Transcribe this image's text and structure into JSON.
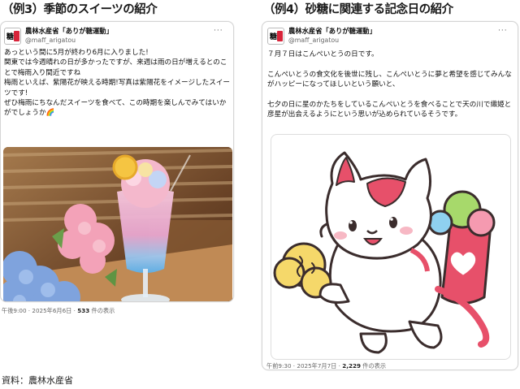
{
  "headings": {
    "left": "（例3）季節のスイーツの紹介",
    "right": "（例4）砂糖に関連する記念日の紹介"
  },
  "account": {
    "name": "農林水産省「ありが糖運動」",
    "handle": "@maff_arigatou",
    "avatar_glyph": "糖",
    "more_icon": "more-dots-icon"
  },
  "post_left": {
    "text": "あっという間に5月が終わり6月に入りました!\n関東では今週晴れの日が多かったですが、来週は雨の日が増えるとのことで梅雨入り間近ですね\n梅雨といえば、紫陽花が映える時期!写真は紫陽花をイメージしたスイーツです!\nぜひ梅雨にちなんだスイーツを食べて、この時期を楽しんでみてはいかがでしょうか🌈",
    "time": "午後9:00 · 2025年6月6日 · ",
    "views_count": "533",
    "views_suffix": " 件の表示"
  },
  "post_right": {
    "text": "７月７日はこんぺいとうの日です。\n\nこんぺいとうの食文化を後世に残し、こんぺいとうに夢と希望を感じてみんながハッピーになってほしいという願いと、\n\n七夕の日に星のかたちをしているこんぺいとうを食べることで天の川で織姫と彦星が出会えるようにという思いが込められているそうです。",
    "time": "午前9:30 · 2025年7月7日 · ",
    "views_count": "2,229",
    "views_suffix": " 件の表示"
  },
  "source": "資料：農林水産省",
  "colors": {
    "brand_red": "#d8243a",
    "card_border": "#d5d5d5",
    "muted_text": "#666666"
  }
}
